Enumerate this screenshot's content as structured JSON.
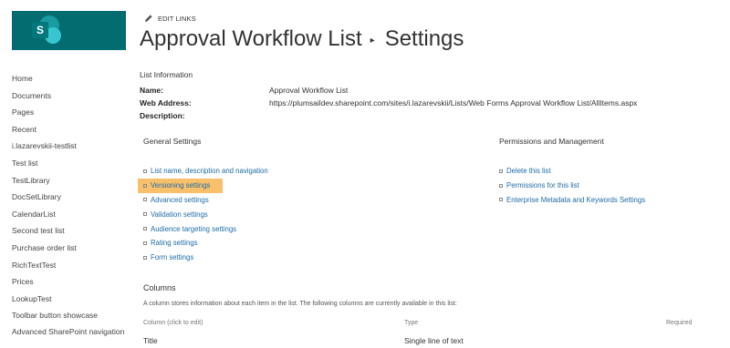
{
  "site": {
    "logo_letter": "S",
    "brand_color": "#036c70"
  },
  "header": {
    "edit_links": "EDIT LINKS",
    "title_part1": "Approval Workflow List",
    "separator": "▸",
    "title_part2": "Settings"
  },
  "nav": {
    "items": [
      "Home",
      "Documents",
      "Pages",
      "Recent",
      "i.lazarevskii-testlist",
      "Test list",
      "TestLibrary",
      "DocSetLibrary",
      "CalendarList",
      "Second test list",
      "Purchase order list",
      "RichTextTest",
      "Prices",
      "LookupTest",
      "Toolbar button showcase",
      "Advanced SharePoint navigation"
    ]
  },
  "list_info": {
    "heading": "List Information",
    "name_label": "Name:",
    "name_value": "Approval Workflow List",
    "address_label": "Web Address:",
    "address_value": "https://plumsaildev.sharepoint.com/sites/i.lazarevskii/Lists/Web Forms Approval Workflow List/AllItems.aspx",
    "description_label": "Description:",
    "description_value": ""
  },
  "general_settings": {
    "heading": "General Settings",
    "links": [
      "List name, description and navigation",
      "Versioning settings",
      "Advanced settings",
      "Validation settings",
      "Audience targeting settings",
      "Rating settings",
      "Form settings"
    ],
    "highlighted_index": 1,
    "highlight_color": "#f9c06c"
  },
  "permissions": {
    "heading": "Permissions and Management",
    "links": [
      "Delete this list",
      "Permissions for this list",
      "Enterprise Metadata and Keywords Settings"
    ]
  },
  "columns": {
    "heading": "Columns",
    "description": "A column stores information about each item in the list. The following columns are currently available in this list:",
    "headers": {
      "column": "Column (click to edit)",
      "type": "Type",
      "required": "Required"
    },
    "rows": [
      {
        "column": "Title",
        "type": "Single line of text",
        "required": ""
      }
    ]
  },
  "colors": {
    "link": "#1f6ba5",
    "text": "#333333"
  }
}
